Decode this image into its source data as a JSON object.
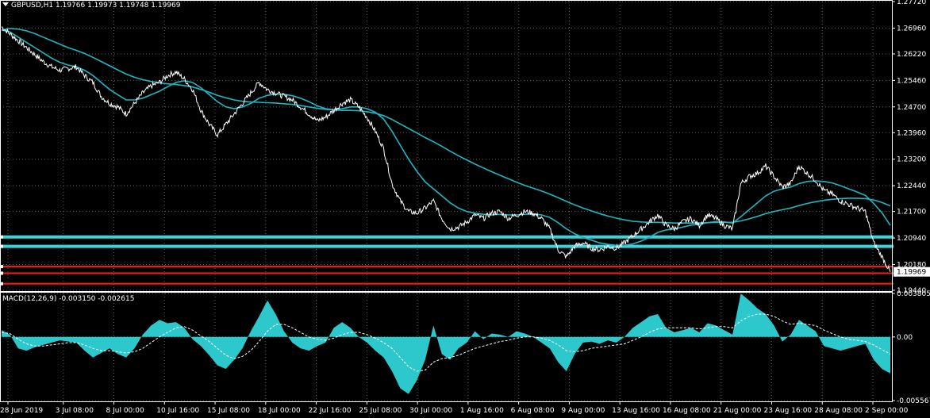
{
  "header": {
    "symbol_info": "GBPUSD,H1  1.19766 1.19973 1.19748 1.19969"
  },
  "macd_header": "MACD(12,26,9) -0.003150 -0.002615",
  "current_price_label": "1.19969",
  "colors": {
    "background": "#000000",
    "price": "#ffffff",
    "moving_average": "#1fb6c2",
    "grid": "#5a5a5a",
    "cyan_level": "#3fd0d8",
    "red_level": "#ff1a1a",
    "histogram": "#2cc8cc",
    "signal": "#ffffff"
  },
  "chart_data": [
    {
      "type": "line",
      "name": "price",
      "y_ticks": [
        "1.27720",
        "1.26960",
        "1.26220",
        "1.25460",
        "1.24700",
        "1.23960",
        "1.23200",
        "1.22440",
        "1.21700",
        "1.20940",
        "1.20180",
        "1.19440"
      ],
      "ylim": [
        1.1944,
        1.2772
      ],
      "x_tick_labels": [
        "28 Jun 2019",
        "3 Jul 08:00",
        "8 Jul 00:00",
        "10 Jul 16:00",
        "15 Jul 08:00",
        "18 Jul 00:00",
        "22 Jul 16:00",
        "25 Jul 08:00",
        "30 Jul 00:00",
        "1 Aug 16:00",
        "6 Aug 08:00",
        "9 Aug 00:00",
        "13 Aug 16:00",
        "16 Aug 08:00",
        "21 Aug 00:00",
        "23 Aug 16:00",
        "28 Aug 08:00",
        "2 Sep 00:00"
      ],
      "close": [
        1.27,
        1.268,
        1.266,
        1.264,
        1.262,
        1.26,
        1.2585,
        1.2575,
        1.258,
        1.2585,
        1.256,
        1.254,
        1.25,
        1.248,
        1.247,
        1.245,
        1.248,
        1.251,
        1.253,
        1.254,
        1.256,
        1.257,
        1.255,
        1.252,
        1.246,
        1.242,
        1.239,
        1.242,
        1.245,
        1.248,
        1.251,
        1.254,
        1.252,
        1.251,
        1.25,
        1.249,
        1.247,
        1.245,
        1.243,
        1.244,
        1.246,
        1.248,
        1.249,
        1.247,
        1.244,
        1.24,
        1.235,
        1.225,
        1.22,
        1.217,
        1.2165,
        1.218,
        1.22,
        1.215,
        1.212,
        1.2125,
        1.214,
        1.216,
        1.215,
        1.2165,
        1.217,
        1.215,
        1.216,
        1.217,
        1.2165,
        1.215,
        1.212,
        1.206,
        1.204,
        1.207,
        1.208,
        1.2065,
        1.206,
        1.207,
        1.2065,
        1.208,
        1.21,
        1.212,
        1.214,
        1.216,
        1.213,
        1.212,
        1.214,
        1.215,
        1.213,
        1.216,
        1.215,
        1.213,
        1.212,
        1.225,
        1.227,
        1.228,
        1.23,
        1.227,
        1.224,
        1.225,
        1.23,
        1.228,
        1.226,
        1.223,
        1.222,
        1.22,
        1.219,
        1.218,
        1.217,
        1.208,
        1.204,
        1.1997
      ],
      "ma_fast": [
        1.269,
        1.2685,
        1.267,
        1.2655,
        1.264,
        1.2625,
        1.261,
        1.2598,
        1.259,
        1.2585,
        1.2575,
        1.256,
        1.254,
        1.252,
        1.2505,
        1.249,
        1.249,
        1.2495,
        1.2505,
        1.2515,
        1.2528,
        1.254,
        1.2545,
        1.254,
        1.2525,
        1.2505,
        1.2485,
        1.247,
        1.2465,
        1.247,
        1.248,
        1.2495,
        1.2503,
        1.2507,
        1.2506,
        1.2502,
        1.2495,
        1.2485,
        1.2473,
        1.2465,
        1.2462,
        1.2465,
        1.247,
        1.247,
        1.2465,
        1.2455,
        1.2435,
        1.24,
        1.236,
        1.232,
        1.2285,
        1.2255,
        1.2235,
        1.2215,
        1.2195,
        1.218,
        1.217,
        1.2165,
        1.2162,
        1.216,
        1.2162,
        1.216,
        1.216,
        1.2162,
        1.2163,
        1.216,
        1.2153,
        1.2138,
        1.212,
        1.2106,
        1.2096,
        1.2088,
        1.208,
        1.2076,
        1.2073,
        1.2073,
        1.2077,
        1.2085,
        1.2096,
        1.211,
        1.2117,
        1.212,
        1.2125,
        1.2131,
        1.2133,
        1.2138,
        1.2141,
        1.214,
        1.2137,
        1.2155,
        1.2175,
        1.2195,
        1.2215,
        1.2228,
        1.2235,
        1.224,
        1.225,
        1.2256,
        1.2258,
        1.2256,
        1.2252,
        1.2244,
        1.2235,
        1.2226,
        1.2216,
        1.2193,
        1.2166,
        1.213
      ],
      "ma_slow": [
        1.269,
        1.2695,
        1.2693,
        1.2688,
        1.268,
        1.267,
        1.266,
        1.265,
        1.264,
        1.2632,
        1.2623,
        1.2612,
        1.26,
        1.2588,
        1.2576,
        1.2564,
        1.2555,
        1.2548,
        1.2543,
        1.2539,
        1.2536,
        1.2534,
        1.2531,
        1.2527,
        1.252,
        1.2512,
        1.2503,
        1.2496,
        1.249,
        1.2486,
        1.2484,
        1.2483,
        1.2482,
        1.2481,
        1.2479,
        1.2477,
        1.2474,
        1.247,
        1.2466,
        1.2463,
        1.2461,
        1.246,
        1.246,
        1.2459,
        1.2456,
        1.2452,
        1.2445,
        1.2434,
        1.2421,
        1.2408,
        1.2395,
        1.2382,
        1.237,
        1.2357,
        1.2343,
        1.233,
        1.2318,
        1.2306,
        1.2295,
        1.2284,
        1.2274,
        1.2264,
        1.2254,
        1.2245,
        1.2237,
        1.2229,
        1.222,
        1.221,
        1.2199,
        1.2189,
        1.218,
        1.2172,
        1.2164,
        1.2157,
        1.2151,
        1.2146,
        1.2142,
        1.214,
        1.2139,
        1.2139,
        1.2138,
        1.2137,
        1.2137,
        1.2137,
        1.2137,
        1.2138,
        1.2139,
        1.2139,
        1.2139,
        1.2143,
        1.2149,
        1.2156,
        1.2164,
        1.217,
        1.2175,
        1.218,
        1.2187,
        1.2193,
        1.2198,
        1.2202,
        1.2205,
        1.2207,
        1.2208,
        1.2208,
        1.2207,
        1.2203,
        1.2196,
        1.2186
      ],
      "levels": {
        "cyan": [
          1.2097,
          1.207
        ],
        "red": [
          1.2012,
          1.1993,
          1.1963
        ]
      }
    },
    {
      "type": "bar",
      "name": "MACD",
      "y_ticks": [
        "0.003805",
        "0.00",
        "-0.005567"
      ],
      "ylim": [
        -0.005567,
        0.003805
      ],
      "histogram": [
        0.0006,
        0.0002,
        -0.001,
        -0.0012,
        -0.0009,
        -0.0007,
        -0.0005,
        -0.0003,
        -0.0004,
        -0.0005,
        -0.0012,
        -0.0018,
        -0.0014,
        -0.001,
        -0.0015,
        -0.0018,
        -0.001,
        0.0002,
        0.001,
        0.0015,
        0.0012,
        0.0013,
        0.0008,
        -0.0002,
        -0.0008,
        -0.0016,
        -0.0025,
        -0.0028,
        -0.002,
        -0.001,
        0.0005,
        0.0018,
        0.0032,
        0.002,
        0.0005,
        -0.0005,
        -0.001,
        -0.0012,
        -0.0008,
        -0.0005,
        0.0008,
        0.0013,
        0.0008,
        0.0,
        -0.0005,
        -0.0012,
        -0.0018,
        -0.003,
        -0.0045,
        -0.005,
        -0.0038,
        -0.002,
        0.001,
        -0.0015,
        -0.002,
        -0.001,
        -0.0005,
        0.0005,
        -0.0002,
        0.0003,
        0.0002,
        0.0,
        0.0005,
        0.0003,
        0.0,
        -0.0005,
        -0.001,
        -0.0022,
        -0.003,
        -0.0015,
        -0.0005,
        -0.0004,
        -0.0006,
        -0.0003,
        -0.0005,
        0.0,
        0.0008,
        0.0013,
        0.0018,
        0.002,
        0.0008,
        0.0004,
        0.0006,
        0.0008,
        0.0004,
        0.0012,
        0.001,
        0.0006,
        0.0002,
        0.0038,
        0.0032,
        0.0025,
        0.002,
        0.001,
        -0.0004,
        0.0002,
        0.0015,
        0.001,
        0.0005,
        -0.0008,
        -0.001,
        -0.0012,
        -0.001,
        -0.0008,
        -0.0006,
        -0.002,
        -0.0028,
        -0.0032
      ],
      "signal": [
        0.0004,
        0.0003,
        -0.0002,
        -0.0006,
        -0.0008,
        -0.0008,
        -0.0007,
        -0.0006,
        -0.0005,
        -0.0005,
        -0.0007,
        -0.001,
        -0.0012,
        -0.0012,
        -0.0013,
        -0.0014,
        -0.0013,
        -0.001,
        -0.0005,
        0.0,
        0.0004,
        0.0008,
        0.0009,
        0.0006,
        0.0001,
        -0.0004,
        -0.001,
        -0.0016,
        -0.0019,
        -0.0017,
        -0.0012,
        -0.0004,
        0.0005,
        0.0011,
        0.0011,
        0.0008,
        0.0004,
        0.0,
        -0.0002,
        -0.0003,
        -0.0001,
        0.0002,
        0.0004,
        0.0004,
        0.0002,
        -0.0001,
        -0.0005,
        -0.001,
        -0.0018,
        -0.0026,
        -0.003,
        -0.0029,
        -0.0022,
        -0.0019,
        -0.0018,
        -0.0016,
        -0.0013,
        -0.001,
        -0.0008,
        -0.0006,
        -0.0004,
        -0.0003,
        -0.0001,
        0.0,
        0.0,
        -0.0001,
        -0.0003,
        -0.0007,
        -0.0012,
        -0.0013,
        -0.0012,
        -0.001,
        -0.0009,
        -0.0008,
        -0.0007,
        -0.0006,
        -0.0003,
        0.0,
        0.0004,
        0.0007,
        0.0008,
        0.0008,
        0.0008,
        0.0008,
        0.0007,
        0.0008,
        0.0009,
        0.0009,
        0.0008,
        0.0014,
        0.0018,
        0.002,
        0.002,
        0.0018,
        0.0014,
        0.0011,
        0.0012,
        0.0011,
        0.001,
        0.0006,
        0.0003,
        0.0,
        -0.0002,
        -0.0003,
        -0.0004,
        -0.0007,
        -0.0011,
        -0.0015
      ]
    }
  ]
}
